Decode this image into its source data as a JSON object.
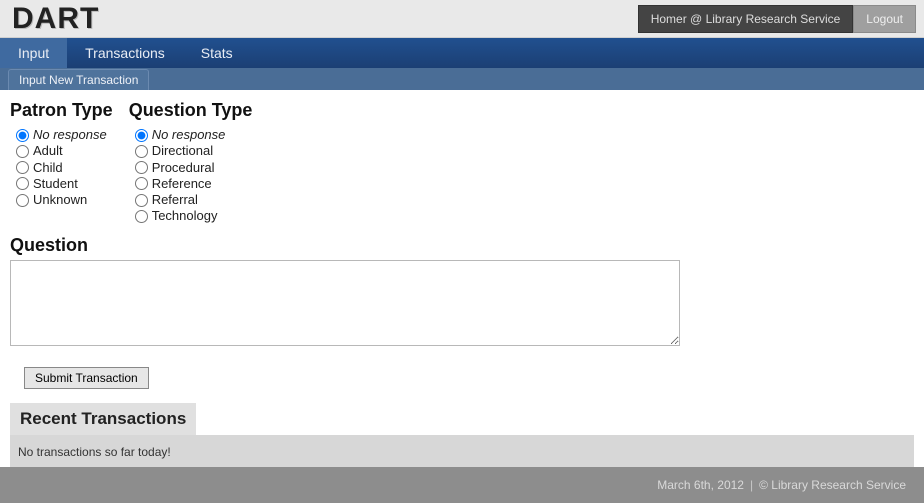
{
  "header": {
    "logo": "DART",
    "user_label": "Homer @ Library Research Service",
    "logout_label": "Logout"
  },
  "nav": {
    "items": [
      {
        "label": "Input",
        "active": true
      },
      {
        "label": "Transactions",
        "active": false
      },
      {
        "label": "Stats",
        "active": false
      }
    ]
  },
  "subnav": {
    "tab_label": "Input New Transaction"
  },
  "form": {
    "patron_type": {
      "heading": "Patron Type",
      "options": [
        {
          "label": "No response",
          "selected": true
        },
        {
          "label": "Adult",
          "selected": false
        },
        {
          "label": "Child",
          "selected": false
        },
        {
          "label": "Student",
          "selected": false
        },
        {
          "label": "Unknown",
          "selected": false
        }
      ]
    },
    "question_type": {
      "heading": "Question Type",
      "options": [
        {
          "label": "No response",
          "selected": true
        },
        {
          "label": "Directional",
          "selected": false
        },
        {
          "label": "Procedural",
          "selected": false
        },
        {
          "label": "Reference",
          "selected": false
        },
        {
          "label": "Referral",
          "selected": false
        },
        {
          "label": "Technology",
          "selected": false
        }
      ]
    },
    "question_label": "Question",
    "question_value": "",
    "submit_label": "Submit Transaction"
  },
  "recent": {
    "heading": "Recent Transactions",
    "empty_message": "No transactions so far today!"
  },
  "footer": {
    "date": "March 6th, 2012",
    "separator": "|",
    "copyright": "© Library Research Service"
  }
}
